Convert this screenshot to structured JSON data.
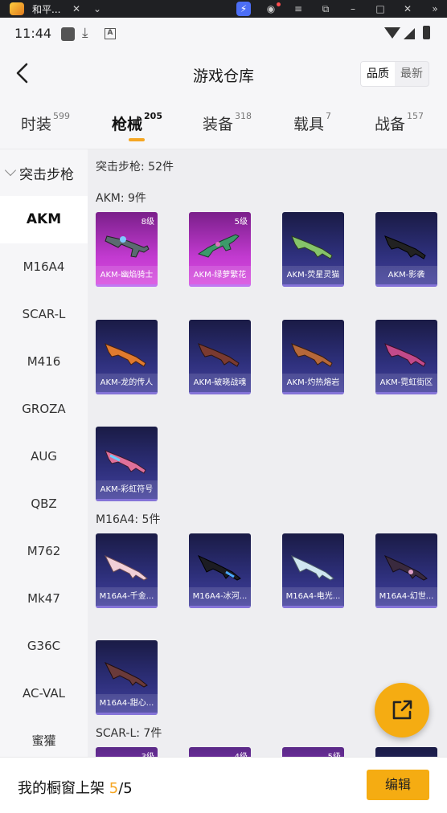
{
  "emulator": {
    "title": "和平..."
  },
  "status_bar": {
    "time": "11:44"
  },
  "header": {
    "title": "游戏仓库",
    "sort_options": [
      "品质",
      "最新"
    ],
    "active_sort": "品质"
  },
  "tabs": [
    {
      "label": "时装",
      "count": "599"
    },
    {
      "label": "枪械",
      "count": "205",
      "active": true
    },
    {
      "label": "装备",
      "count": "318"
    },
    {
      "label": "载具",
      "count": "7"
    },
    {
      "label": "战备",
      "count": "157"
    }
  ],
  "sidebar": {
    "group_label": "突击步枪",
    "items": [
      "AKM",
      "M16A4",
      "SCAR-L",
      "M416",
      "GROZA",
      "AUG",
      "QBZ",
      "M762",
      "Mk47",
      "G36C",
      "AC-VAL",
      "蜜獾"
    ],
    "active": "AKM"
  },
  "main": {
    "summary": "突击步枪: 52件",
    "sections": [
      {
        "label": "AKM: 9件",
        "items": [
          {
            "name": "AKM-幽焰骑士",
            "level": "8级",
            "color": "#8e2fc1"
          },
          {
            "name": "AKM-绿萝繁花",
            "level": "5级",
            "color": "#c23ad0"
          },
          {
            "name": "AKM-荧星灵猫",
            "level": "",
            "color": "#2d2f7a"
          },
          {
            "name": "AKM-影袭",
            "level": "",
            "color": "#2d2f7a"
          },
          {
            "name": "AKM-龙的传人",
            "level": "",
            "color": "#2d2f7a"
          },
          {
            "name": "AKM-破晓战魂",
            "level": "",
            "color": "#2d2f7a"
          },
          {
            "name": "AKM-灼热熔岩",
            "level": "",
            "color": "#2d2f7a"
          },
          {
            "name": "AKM-霓虹街区",
            "level": "",
            "color": "#2d2f7a"
          },
          {
            "name": "AKM-彩虹符号",
            "level": "",
            "color": "#2d2f7a"
          }
        ]
      },
      {
        "label": "M16A4: 5件",
        "items": [
          {
            "name": "M16A4-千金...",
            "level": ""
          },
          {
            "name": "M16A4-冰河...",
            "level": ""
          },
          {
            "name": "M16A4-电光...",
            "level": ""
          },
          {
            "name": "M16A4-幻世...",
            "level": ""
          },
          {
            "name": "M16A4-甜心...",
            "level": ""
          }
        ]
      },
      {
        "label": "SCAR-L: 7件",
        "items": [
          {
            "name": "",
            "level": "3级"
          },
          {
            "name": "",
            "level": "4级"
          },
          {
            "name": "",
            "level": "5级"
          },
          {
            "name": "",
            "level": ""
          }
        ]
      }
    ]
  },
  "bottom_bar": {
    "shelf_label": "我的橱窗上架",
    "shelf_current": "5",
    "shelf_total": "/5",
    "edit_label": "编辑"
  },
  "colors": {
    "accent": "#f5ac12",
    "tab_underline": "#f5a623"
  }
}
